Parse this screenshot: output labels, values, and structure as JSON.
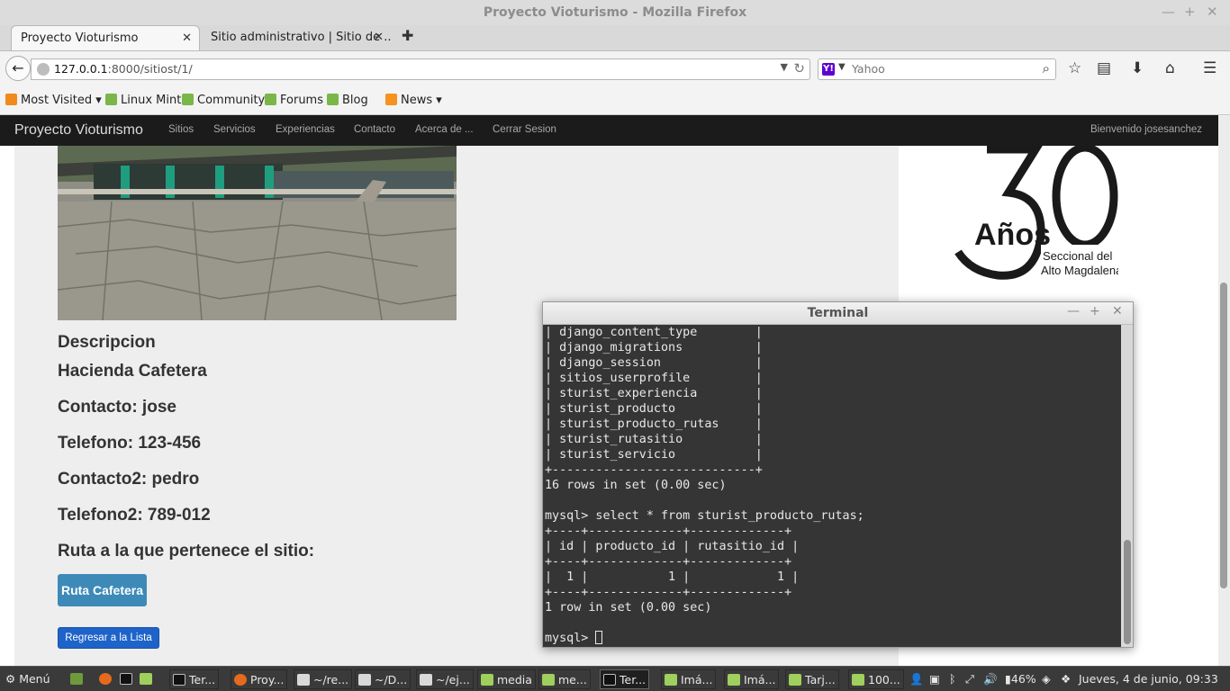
{
  "window": {
    "title": "Proyecto Vioturismo - Mozilla Firefox"
  },
  "tabs": [
    {
      "label": "Proyecto Vioturismo",
      "active": true
    },
    {
      "label": "Sitio administrativo | Sitio de ...",
      "active": false
    }
  ],
  "urlbar": {
    "host": "127.0.0.1",
    "rest": ":8000/sitiost/1/"
  },
  "search": {
    "engine": "Y!",
    "placeholder": "Yahoo"
  },
  "bookmarks": [
    "Most Visited",
    "Linux Mint",
    "Community",
    "Forums",
    "Blog",
    "News"
  ],
  "site": {
    "brand": "Proyecto Vioturismo",
    "nav": [
      "Sitios",
      "Servicios",
      "Experiencias",
      "Contacto",
      "Acerca de ...",
      "Cerrar Sesion"
    ],
    "welcome": "Bienvenido josesanchez"
  },
  "detail": {
    "heading": "Descripcion",
    "description": "Hacienda Cafetera",
    "contacto": "Contacto: jose",
    "telefono": "Telefono: 123-456",
    "contacto2": "Contacto2: pedro",
    "telefono2": "Telefono2: 789-012",
    "ruta_heading": "Ruta a la que pertenece el sitio:",
    "ruta_button": "Ruta Cafetera",
    "back_button": "Regresar a la Lista"
  },
  "logo": {
    "number": "30",
    "word": "Años",
    "line1": "Seccional del",
    "line2": "Alto Magdalena"
  },
  "terminal": {
    "title": "Terminal",
    "lines": [
      "| django_content_type        |",
      "| django_migrations          |",
      "| django_session             |",
      "| sitios_userprofile         |",
      "| sturist_experiencia        |",
      "| sturist_producto           |",
      "| sturist_producto_rutas     |",
      "| sturist_rutasitio          |",
      "| sturist_servicio           |",
      "+----------------------------+",
      "16 rows in set (0.00 sec)",
      "",
      "mysql> select * from sturist_producto_rutas;",
      "+----+-------------+-------------+",
      "| id | producto_id | rutasitio_id |",
      "+----+-------------+-------------+",
      "|  1 |           1 |            1 |",
      "+----+-------------+-------------+",
      "1 row in set (0.00 sec)",
      "",
      "mysql> "
    ]
  },
  "taskbar": {
    "menu": "Menú",
    "items": [
      "Ter...",
      "Proy...",
      "~/re...",
      "~/D...",
      "~/ej...",
      "media",
      "me...",
      "Ter...",
      "Imá...",
      "Imá...",
      "Tarj...",
      "100..."
    ],
    "battery": "46%",
    "clock": "Jueves,  4 de junio, 09:33"
  }
}
